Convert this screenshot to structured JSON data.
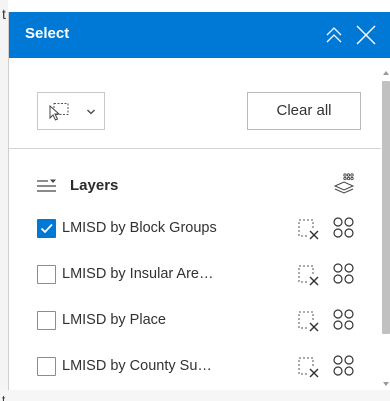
{
  "background": {
    "text_a": "t",
    "text_b": "t"
  },
  "panel": {
    "title": "Select",
    "accent": "#0079d6",
    "header_icons": [
      "chevrons-up-icon",
      "close-icon"
    ]
  },
  "toolbar": {
    "select_tool_icon": "select-rectangle-cursor-icon",
    "clear_all_label": "Clear all"
  },
  "layers": {
    "heading": "Layers",
    "items": [
      {
        "label": "LMISD by Block Groups",
        "checked": true
      },
      {
        "label": "LMISD by Insular Are…",
        "checked": false
      },
      {
        "label": "LMISD by Place",
        "checked": false
      },
      {
        "label": "LMISD by County Su…",
        "checked": false
      }
    ]
  }
}
